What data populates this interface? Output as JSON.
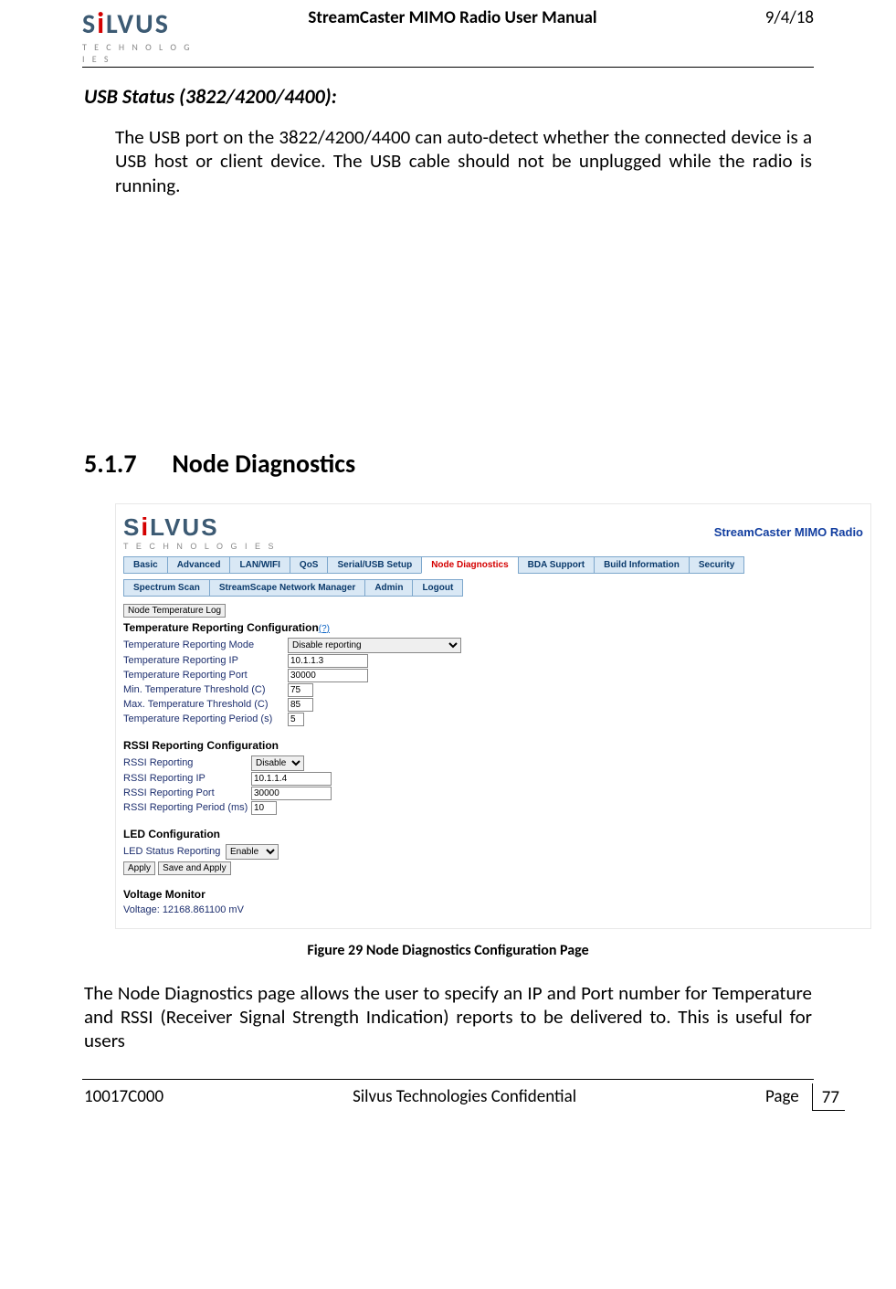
{
  "logo": {
    "brand": "SiLVUS",
    "sub": "T E C H N O L O G I E S"
  },
  "header": {
    "title": "StreamCaster MIMO Radio User Manual",
    "date": "9/4/18"
  },
  "heading_usb": "USB Status (3822/4200/4400):",
  "para_usb": "The USB port on the 3822/4200/4400 can auto-detect whether the connected device is a USB host or client device. The USB cable should not be unplugged while the radio is running.",
  "section_num": "5.1.7",
  "section_title": "Node Diagnostics",
  "figure": {
    "subtitle": "StreamCaster MIMO Radio",
    "tabs_row1": [
      "Basic",
      "Advanced",
      "LAN/WIFI",
      "QoS",
      "Serial/USB Setup",
      "Node Diagnostics",
      "BDA Support",
      "Build Information",
      "Security"
    ],
    "tabs_row1_selected": 5,
    "tabs_row2": [
      "Spectrum Scan",
      "StreamScape Network Manager",
      "Admin",
      "Logout"
    ],
    "node_temp_btn": "Node Temperature Log",
    "temp_section": "Temperature Reporting Configuration",
    "help": "(?)",
    "temp_labels": {
      "mode": "Temperature Reporting Mode",
      "ip": "Temperature Reporting IP",
      "port": "Temperature Reporting Port",
      "min": "Min. Temperature Threshold (C)",
      "max": "Max. Temperature Threshold (C)",
      "period": "Temperature Reporting Period (s)"
    },
    "temp_values": {
      "mode": "Disable reporting",
      "ip": "10.1.1.3",
      "port": "30000",
      "min": "75",
      "max": "85",
      "period": "5"
    },
    "rssi_section": "RSSI Reporting Configuration",
    "rssi_labels": {
      "reporting": "RSSI Reporting",
      "ip": "RSSI Reporting IP",
      "port": "RSSI Reporting Port",
      "period": "RSSI Reporting Period (ms)"
    },
    "rssi_values": {
      "reporting": "Disable",
      "ip": "10.1.1.4",
      "port": "30000",
      "period": "10"
    },
    "led_section": "LED Configuration",
    "led_label": "LED Status Reporting",
    "led_value": "Enable",
    "apply_btn": "Apply",
    "save_btn": "Save and Apply",
    "volt_section": "Voltage Monitor",
    "volt_text": "Voltage: 12168.861100 mV"
  },
  "caption": "Figure 29 Node Diagnostics Configuration Page",
  "para_after": "The Node Diagnostics page allows the user to specify an IP and Port number for Temperature and RSSI (Receiver Signal Strength Indication) reports to be delivered to. This is useful for users",
  "footer": {
    "left": "10017C000",
    "mid": "Silvus Technologies Confidential",
    "page_label": "Page",
    "page_num": "77"
  }
}
